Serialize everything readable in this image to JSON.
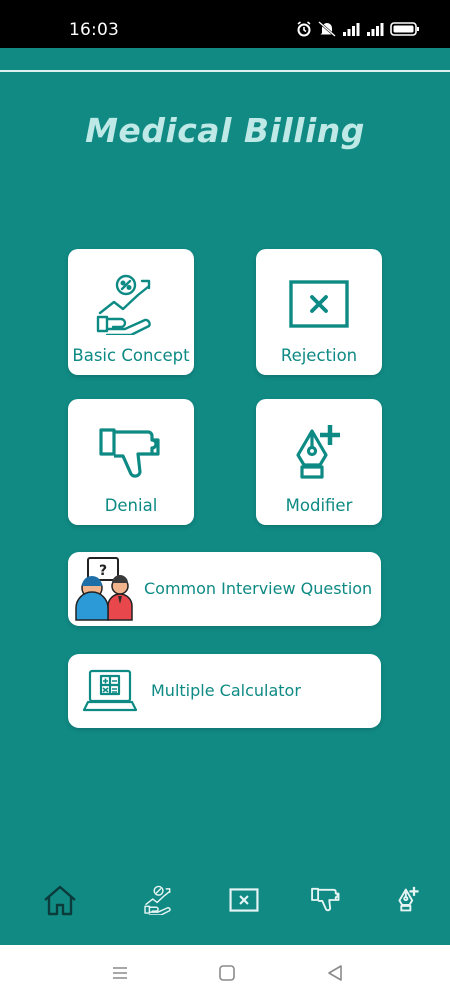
{
  "status_bar": {
    "time": "16:03",
    "icons": [
      "alarm-icon",
      "mute-icon",
      "signal-icon",
      "signal-icon",
      "battery-icon"
    ]
  },
  "app": {
    "title": "Medical Billing"
  },
  "tiles": [
    {
      "label": "Basic Concept",
      "icon": "hand-growth-icon"
    },
    {
      "label": "Rejection",
      "icon": "rejection-icon"
    },
    {
      "label": "Denial",
      "icon": "thumbs-down-icon"
    },
    {
      "label": "Modifier",
      "icon": "pen-plus-icon"
    }
  ],
  "wide_items": [
    {
      "label": "Common Interview Question",
      "icon": "interview-icon"
    },
    {
      "label": "Multiple Calculator",
      "icon": "calculator-icon"
    }
  ],
  "bottom_nav": [
    {
      "icon": "home-icon",
      "active": true
    },
    {
      "icon": "hand-growth-icon",
      "active": false
    },
    {
      "icon": "rejection-icon",
      "active": false
    },
    {
      "icon": "thumbs-down-icon",
      "active": false
    },
    {
      "icon": "pen-plus-icon",
      "active": false
    }
  ],
  "system_nav": [
    "menu-icon",
    "home-square-icon",
    "back-icon"
  ],
  "colors": {
    "background": "#118a84",
    "accent": "#0e8a84",
    "title": "#bfe9e6"
  }
}
